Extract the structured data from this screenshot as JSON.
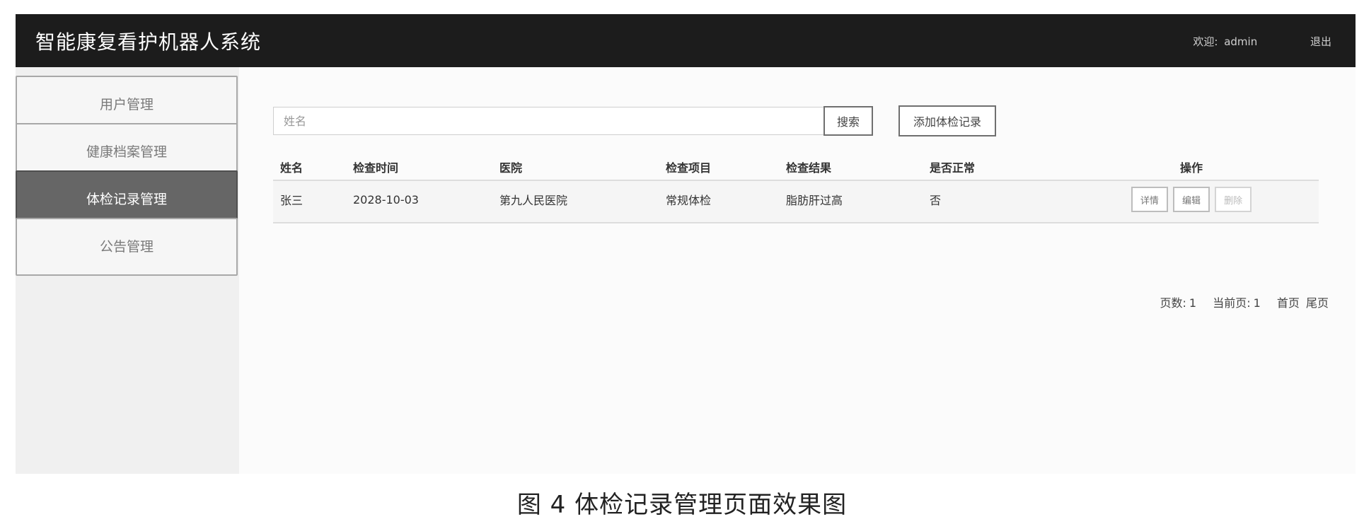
{
  "header": {
    "app_title": "智能康复看护机器人系统",
    "welcome_label": "欢迎:",
    "username": "admin",
    "logout_label": "退出"
  },
  "sidebar": {
    "items": [
      {
        "label": "用户管理",
        "active": false
      },
      {
        "label": "健康档案管理",
        "active": false
      },
      {
        "label": "体检记录管理",
        "active": true
      },
      {
        "label": "公告管理",
        "active": false
      }
    ]
  },
  "search": {
    "placeholder": "姓名",
    "value": "",
    "search_label": "搜索",
    "add_label": "添加体检记录"
  },
  "table": {
    "headers": [
      "姓名",
      "检查时间",
      "医院",
      "检查项目",
      "检查结果",
      "是否正常",
      "操作"
    ],
    "rows": [
      {
        "name": "张三",
        "check_time": "2028-10-03",
        "hospital": "第九人民医院",
        "item": "常规体检",
        "result": "脂肪肝过高",
        "normal": "否",
        "actions": {
          "detail": "详情",
          "edit": "编辑",
          "delete": "删除"
        }
      }
    ]
  },
  "pagination": {
    "pages_label": "页数:",
    "pages_value": "1",
    "current_label": "当前页:",
    "current_value": "1",
    "first_label": "首页",
    "last_label": "尾页"
  },
  "caption": {
    "text": "图 4   体检记录管理页面效果图"
  },
  "colors": {
    "topbar_bg": "#1c1c1c",
    "sidebar_active_bg": "#666666",
    "page_bg": "#fbfbfb"
  }
}
